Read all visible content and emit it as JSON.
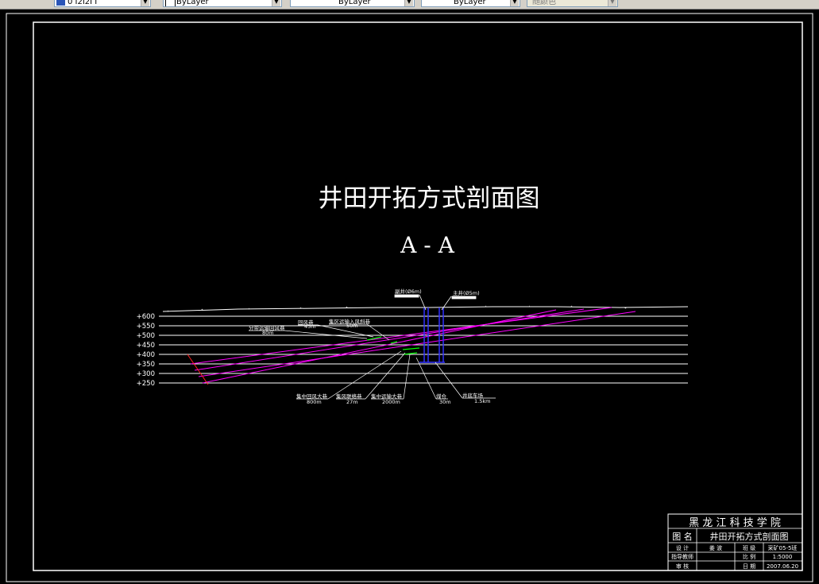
{
  "toolbar": {
    "layer_value": "0 I2I2I I",
    "color_value": "ByLayer",
    "linetype_value": "ByLayer",
    "lineweight_value": "ByLayer",
    "plotstyle_value": "随颜色"
  },
  "drawing": {
    "title": "井田开拓方式剖面图",
    "section": "A - A",
    "elevations": [
      "+600",
      "+550",
      "+500",
      "+450",
      "+400",
      "+350",
      "+300",
      "+250"
    ],
    "shaft_labels": [
      {
        "name": "副井(Ø6m)"
      },
      {
        "name": "主井(Ø5m)"
      }
    ],
    "upper_labels": [
      {
        "name": "回风巷"
      },
      {
        "name": "集区运输入风斜巷"
      },
      {
        "name": "分带运输回风巷"
      }
    ],
    "upper_sublabels": [
      "45m",
      "50m",
      "80m"
    ],
    "bottom_labels": [
      {
        "name": "集中回风大巷",
        "len": "800m"
      },
      {
        "name": "集风联络巷",
        "len": "27m"
      },
      {
        "name": "集中运输大巷",
        "len": "2000m"
      },
      {
        "name": "煤仓",
        "len": "30m"
      },
      {
        "name": "井底车场",
        "len": "1.5km"
      }
    ]
  },
  "titleblock": {
    "school": "黑 龙 江 科 技 学 院",
    "name_label": "图 名",
    "name_value": "井田开拓方式剖面图",
    "design_label": "设 计",
    "design_value": "姜 波",
    "class_label": "班 级",
    "class_value": "采矿05-5班",
    "teacher_label": "指导教师",
    "scale_label": "比 例",
    "scale_value": "1:5000",
    "review_label": "审 核",
    "date_label": "日 期",
    "date_value": "2007.06.20"
  },
  "colors": {
    "background": "#000000",
    "lines": "#ffffff",
    "seams": "#ff00ff",
    "shaft": "#3030ff",
    "roadway": "#00ff00",
    "fault": "#ff0000"
  }
}
